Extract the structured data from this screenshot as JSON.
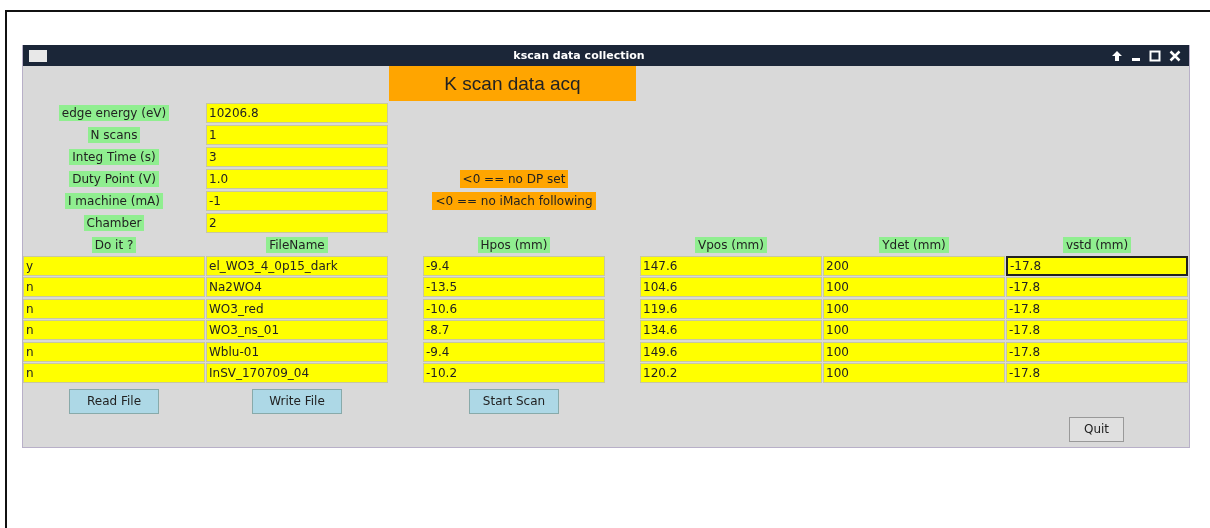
{
  "window": {
    "title": "kscan data collection"
  },
  "heading": "K scan data acq",
  "settings": [
    {
      "label": "edge energy (eV)",
      "value": "10206.8"
    },
    {
      "label": "N scans",
      "value": "1"
    },
    {
      "label": "Integ Time (s)",
      "value": "3"
    },
    {
      "label": "Duty Point (V)",
      "value": "1.0",
      "note": "<0 == no DP set"
    },
    {
      "label": "I machine (mA)",
      "value": "-1",
      "note": "<0 == no iMach following"
    },
    {
      "label": "Chamber",
      "value": "2"
    }
  ],
  "table": {
    "columns": [
      "Do it ?",
      "FileName",
      "Hpos (mm)",
      "Vpos (mm)",
      "Ydet (mm)",
      "vstd (mm)"
    ],
    "rows": [
      {
        "cells": [
          {
            "value": "y",
            "focused": false
          },
          {
            "value": "el_WO3_4_0p15_dark",
            "focused": false
          },
          {
            "value": "-9.4",
            "focused": false
          },
          {
            "value": "147.6",
            "focused": false
          },
          {
            "value": "200",
            "focused": false
          },
          {
            "value": "-17.8",
            "focused": true
          }
        ]
      },
      {
        "cells": [
          {
            "value": "n",
            "focused": false
          },
          {
            "value": "Na2WO4",
            "focused": false
          },
          {
            "value": "-13.5",
            "focused": false
          },
          {
            "value": "104.6",
            "focused": false
          },
          {
            "value": "100",
            "focused": false
          },
          {
            "value": "-17.8",
            "focused": false
          }
        ]
      },
      {
        "cells": [
          {
            "value": "n",
            "focused": false
          },
          {
            "value": "WO3_red",
            "focused": false
          },
          {
            "value": "-10.6",
            "focused": false
          },
          {
            "value": "119.6",
            "focused": false
          },
          {
            "value": "100",
            "focused": false
          },
          {
            "value": "-17.8",
            "focused": false
          }
        ]
      },
      {
        "cells": [
          {
            "value": "n",
            "focused": false
          },
          {
            "value": "WO3_ns_01",
            "focused": false
          },
          {
            "value": "-8.7",
            "focused": false
          },
          {
            "value": "134.6",
            "focused": false
          },
          {
            "value": "100",
            "focused": false
          },
          {
            "value": "-17.8",
            "focused": false
          }
        ]
      },
      {
        "cells": [
          {
            "value": "n",
            "focused": false
          },
          {
            "value": "Wblu-01",
            "focused": false
          },
          {
            "value": "-9.4",
            "focused": false
          },
          {
            "value": "149.6",
            "focused": false
          },
          {
            "value": "100",
            "focused": false
          },
          {
            "value": "-17.8",
            "focused": false
          }
        ]
      },
      {
        "cells": [
          {
            "value": "n",
            "focused": false
          },
          {
            "value": "InSV_170709_04",
            "focused": false
          },
          {
            "value": "-10.2",
            "focused": false
          },
          {
            "value": "120.2",
            "focused": false
          },
          {
            "value": "100",
            "focused": false
          },
          {
            "value": "-17.8",
            "focused": false
          }
        ]
      }
    ]
  },
  "buttons": [
    "Read File",
    "Write File",
    "Start Scan"
  ],
  "quit_button": "Quit"
}
